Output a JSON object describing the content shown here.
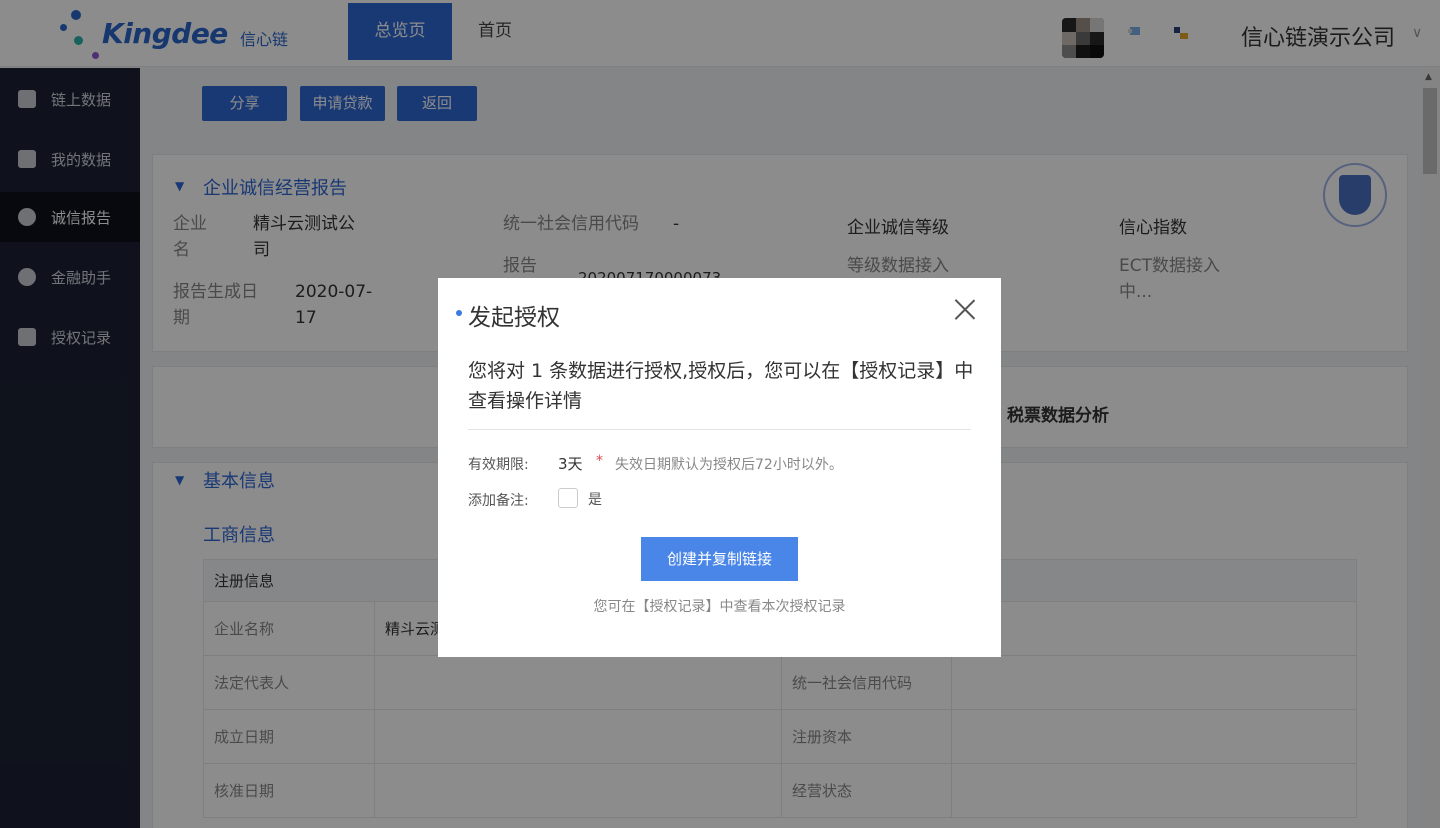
{
  "header": {
    "logo_text": "Kingdee",
    "logo_sub": "信心链",
    "tabs": [
      {
        "label": "总览页",
        "active": true
      },
      {
        "label": "首页",
        "active": false
      }
    ],
    "company": "信心链演示公司",
    "company_caret": "∨"
  },
  "sidebar": {
    "items": [
      {
        "label": "链上数据",
        "icon": "chain-data-icon",
        "active": false
      },
      {
        "label": "我的数据",
        "icon": "bar-chart-icon",
        "active": false
      },
      {
        "label": "诚信报告",
        "icon": "badge-star-icon",
        "active": true
      },
      {
        "label": "金融助手",
        "icon": "yen-coin-icon",
        "active": false
      },
      {
        "label": "授权记录",
        "icon": "record-list-icon",
        "active": false
      }
    ]
  },
  "toolbar": {
    "share": "分享",
    "apply_loan": "申请贷款",
    "back": "返回"
  },
  "report": {
    "title": "企业诚信经营报告",
    "company_name_label_1": "企业",
    "company_name_label_2": "名",
    "company_name_1": "精斗云测试公",
    "company_name_2": "司",
    "date_label_1": "报告生成日",
    "date_label_2": "期",
    "date_value_1": "2020-07-",
    "date_value_2": "17",
    "credit_code_label": "统一社会信用代码",
    "credit_code_value": "-",
    "report_no_label": "报告",
    "report_no_value": "202007170000073",
    "grade_label": "企业诚信等级",
    "grade_value": "等级数据接入",
    "index_label": "信心指数",
    "index_value_1": "ECT数据接入",
    "index_value_2": "中..."
  },
  "tabs_card": {
    "tax_tab": "税票数据分析"
  },
  "basic": {
    "title": "基本信息",
    "subtitle": "工商信息",
    "table_head": "注册信息",
    "rows": [
      {
        "l1": "企业名称",
        "v1": "精斗云测",
        "l2": "",
        "v2": ""
      },
      {
        "l1": "法定代表人",
        "v1": "",
        "l2": "统一社会信用代码",
        "v2": ""
      },
      {
        "l1": "成立日期",
        "v1": "",
        "l2": "注册资本",
        "v2": ""
      },
      {
        "l1": "核准日期",
        "v1": "",
        "l2": "经营状态",
        "v2": ""
      }
    ]
  },
  "modal": {
    "title": "发起授权",
    "message": "您将对 1 条数据进行授权,授权后，您可以在【授权记录】中查看操作详情",
    "validity_label": "有效期限:",
    "validity_value": "3天",
    "required_mark": "*",
    "validity_hint": "失效日期默认为授权后72小时以外。",
    "note_label": "添加备注:",
    "note_option": "是",
    "note_checked": false,
    "primary_button": "创建并复制链接",
    "footer_hint": "您可在【授权记录】中查看本次授权记录"
  },
  "colors": {
    "primary": "#2f68d6",
    "modal_button": "#4a86e8",
    "sidebar_bg": "#1c2233",
    "required": "#e24a4a"
  }
}
